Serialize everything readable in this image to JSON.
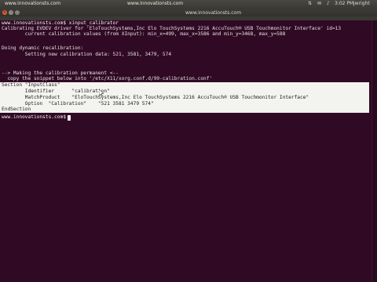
{
  "panel": {
    "site_left": "www.innovationsts.com",
    "site_center": "www.innovationsts.com",
    "clock": "3:02 PM",
    "user": "jwright"
  },
  "titlebar": {
    "title": "www.innovationsts.com"
  },
  "terminal": {
    "lines": [
      "www.innovationsts.com$ xinput_calibrator",
      "Calibrating EVDEV driver for 'EloTouchSystems,Inc Elo TouchSystems 2216 AccuTouch® USB Touchmonitor Interface' id=13",
      "        current calibration values (from XInput): min_x=499, max_x=3586 and min_y=3468, max_y=588",
      "",
      "Doing dynamic recalibration:",
      "        Setting new calibration data: 521, 3581, 3479, 574",
      "",
      "",
      "--> Making the calibration permanent <--",
      "  copy the snippet below into '/etc/X11/xorg.conf.d/99-calibration.conf'"
    ],
    "selected_lines": [
      "Section \"InputClass\"",
      "        Identifier      \"calibration\"",
      "        MatchProduct    \"EloTouchSystems,Inc Elo TouchSystems 2216 AccuTouch® USB Touchmonitor Interface\"",
      "        Option  \"Calibration\"    \"521 3581 3479 574\"",
      "EndSection"
    ],
    "prompt": "www.innovationsts.com$"
  },
  "colors": {
    "terminal_bg": "#300a24",
    "selection_bg": "#f3f3f0",
    "close_button": "#e25b35"
  },
  "icons": {
    "close": "close-icon",
    "minimize": "minimize-icon",
    "maximize": "maximize-icon"
  }
}
